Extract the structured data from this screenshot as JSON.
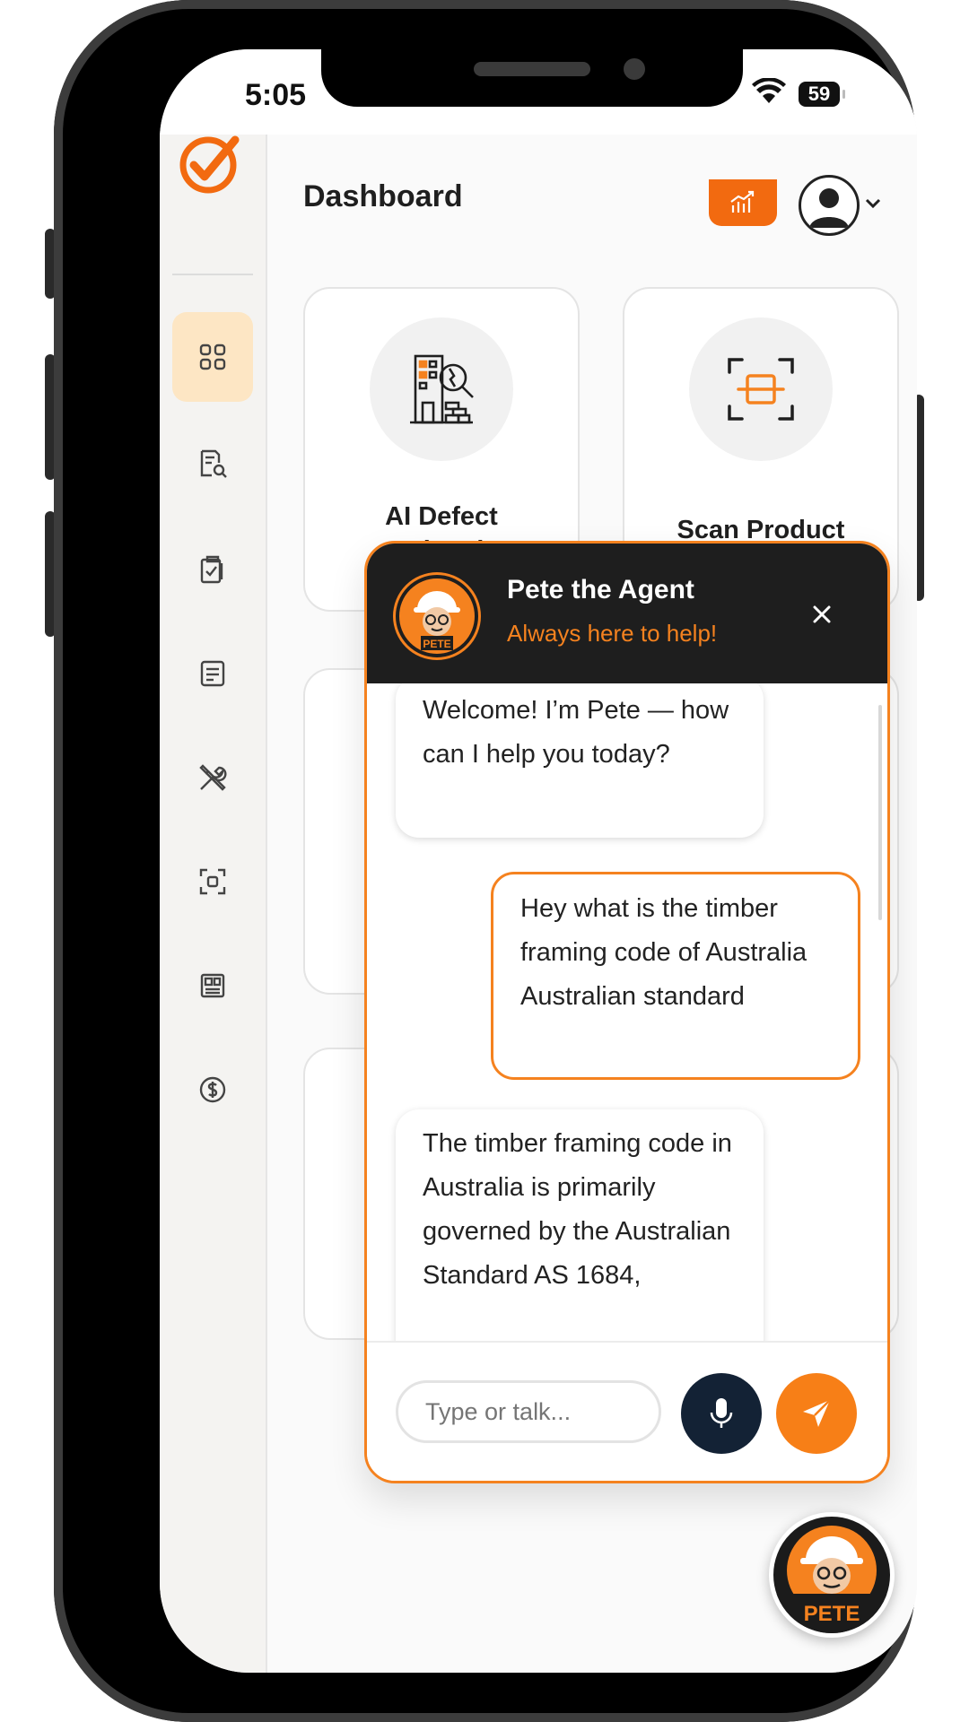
{
  "status_bar": {
    "time": "5:05",
    "battery": "59"
  },
  "header": {
    "title": "Dashboard"
  },
  "sidebar": {
    "items": [
      {
        "icon": "grid-icon",
        "active": true
      },
      {
        "icon": "document-search-icon"
      },
      {
        "icon": "clipboard-check-icon"
      },
      {
        "icon": "notes-icon"
      },
      {
        "icon": "tools-icon"
      },
      {
        "icon": "scan-frame-icon"
      },
      {
        "icon": "layout-icon"
      },
      {
        "icon": "dollar-icon"
      }
    ]
  },
  "cards": [
    {
      "label": "AI Defect\nWizard",
      "icon": "building-inspect-icon"
    },
    {
      "label": "Scan Product",
      "icon": "scan-barcode-icon"
    }
  ],
  "chat": {
    "name": "Pete the Agent",
    "subtitle": "Always here to help!",
    "avatar_label": "PETE",
    "messages": [
      {
        "role": "bot",
        "text": "Welcome! I’m Pete — how can I help you today?"
      },
      {
        "role": "user",
        "text": "Hey what is the timber framing code of Australia Australian standard"
      },
      {
        "role": "bot",
        "text": "The timber framing code in Australia is primarily governed by the Australian Standard AS 1684,"
      }
    ],
    "input_placeholder": "Type or talk..."
  },
  "fab": {
    "label": "PETE"
  },
  "colors": {
    "accent": "#f5821f",
    "dark": "#1e1e1e",
    "mic": "#132235"
  }
}
